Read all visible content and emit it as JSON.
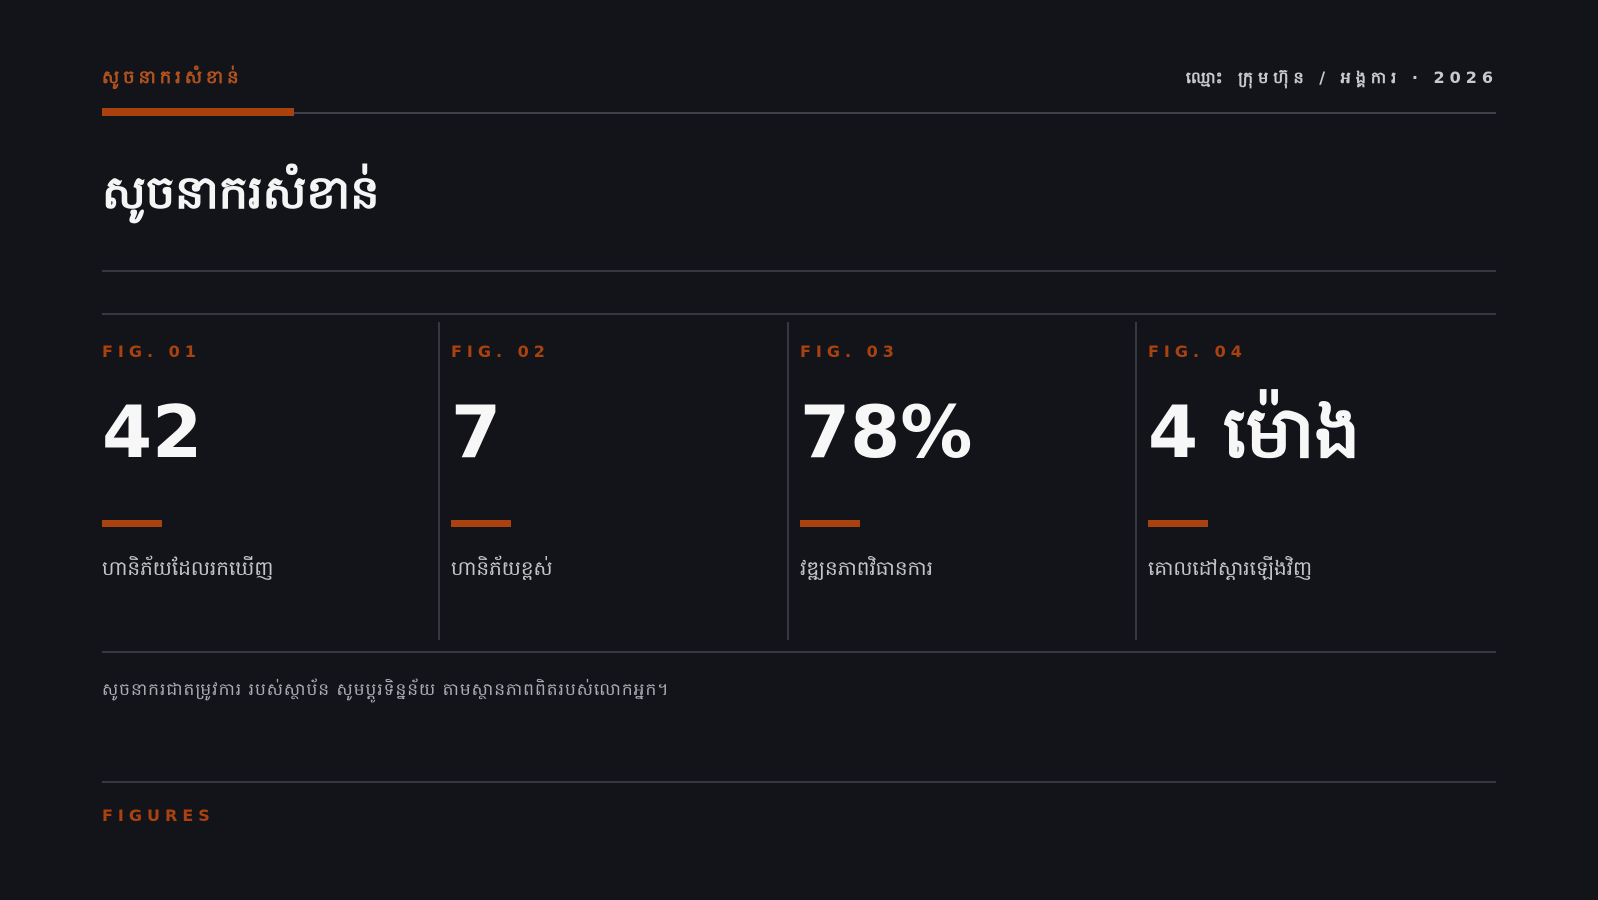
{
  "header": {
    "kicker": "សូចនាករសំខាន់",
    "meta": "ឈ្មោះ ក្រុមហ៊ុន / អង្គការ · 2026"
  },
  "page": {
    "title": "សូចនាករសំខាន់"
  },
  "figures": [
    {
      "label": "FIG. 01",
      "value": "42",
      "caption": "ហានិភ័យដែលរកឃើញ"
    },
    {
      "label": "FIG. 02",
      "value": "7",
      "caption": "ហានិភ័យខ្ពស់"
    },
    {
      "label": "FIG. 03",
      "value": "78%",
      "caption": "វឌ្ឍនភាពវិធានការ"
    },
    {
      "label": "FIG. 04",
      "value": "4 ម៉ោង",
      "caption": "គោលដៅស្ដារឡើងវិញ"
    }
  ],
  "footnote": "សូចនាករជាតម្រូវការ របស់ស្ថាប័ន សូមប្តូរទិន្នន័យ តាមស្ថានភាពពិតរបស់លោកអ្នក។",
  "footer": {
    "label": "FIGURES"
  },
  "colors": {
    "accent": "#a9420f",
    "background": "#121419"
  }
}
